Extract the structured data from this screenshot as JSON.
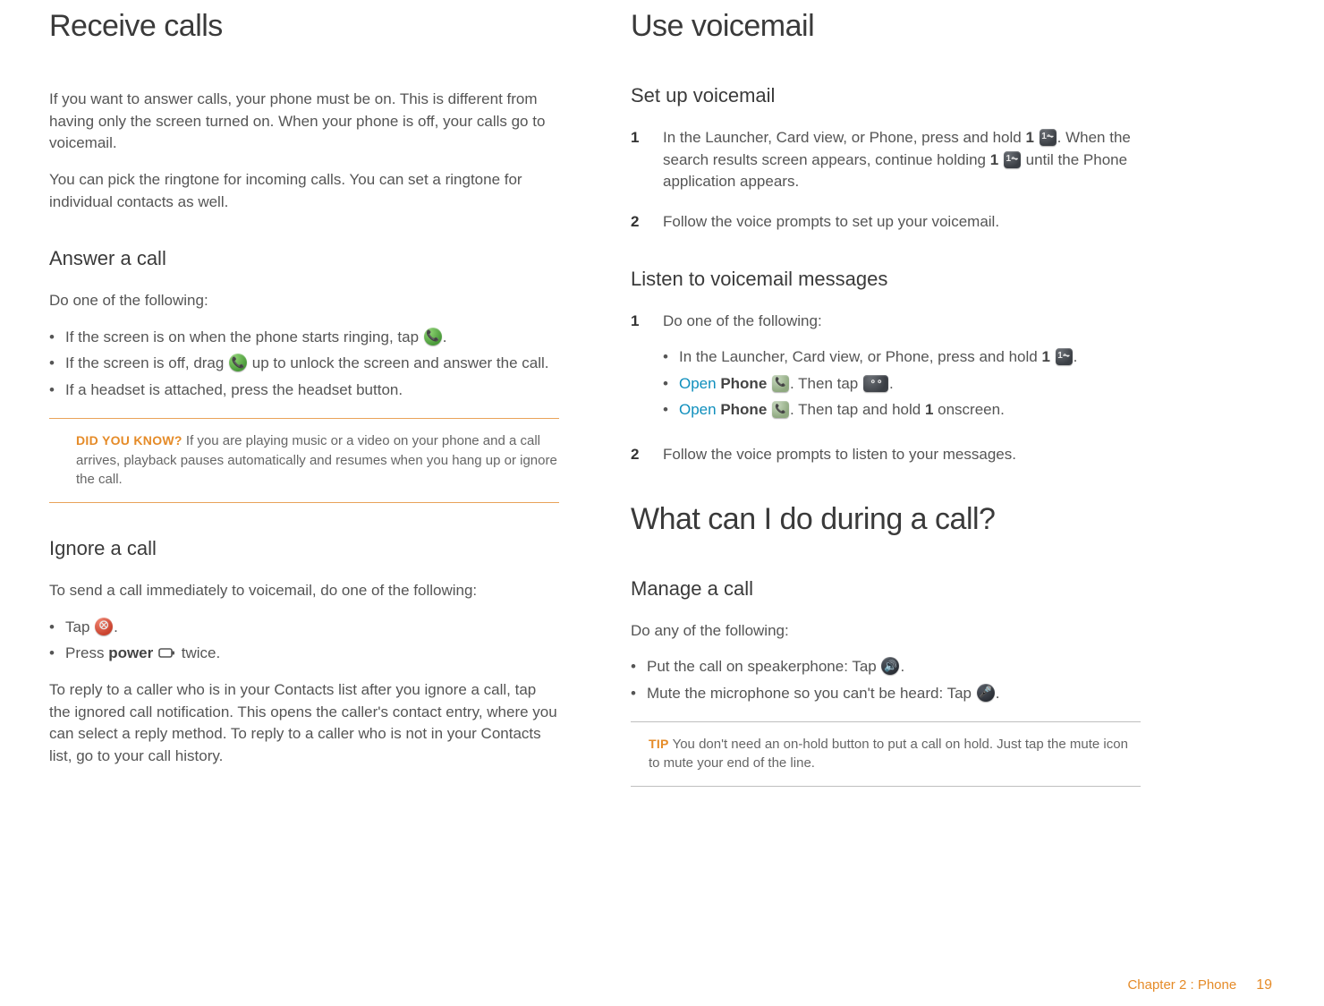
{
  "left": {
    "h1": "Receive calls",
    "intro1": "If you want to answer calls, your phone must be on. This is different from having only the screen turned on. When your phone is off, your calls go to voicemail.",
    "intro2": "You can pick the ringtone for incoming calls. You can set a ringtone for individual contacts as well.",
    "answer_h2": "Answer a call",
    "answer_lead": "Do one of the following:",
    "answer_b1a": "If the screen is on when the phone starts ringing, tap ",
    "answer_b1b": ".",
    "answer_b2a": "If the screen is off, drag ",
    "answer_b2b": " up to unlock the screen and answer the call.",
    "answer_b3": "If a headset is attached, press the headset button.",
    "dyk_label": "DID YOU KNOW?",
    "dyk_body": "  If you are playing music or a video on your phone and a call arrives, playback pauses automatically and resumes when you hang up or ignore the call.",
    "ignore_h2": "Ignore a call",
    "ignore_lead": "To send a call immediately to voicemail, do one of the following:",
    "ignore_b1a": "Tap ",
    "ignore_b1b": ".",
    "ignore_b2a": "Press ",
    "ignore_b2_strong": "power",
    "ignore_b2b": " twice.",
    "ignore_para": "To reply to a caller who is in your Contacts list after you ignore a call, tap the ignored call notification. This opens the caller's contact entry, where you can select a reply method. To reply to a caller who is not in your Contacts list, go to your call history."
  },
  "right": {
    "h1": "Use voicemail",
    "setup_h2": "Set up voicemail",
    "setup_s1a": "In the Launcher, Card view, or Phone, press and hold ",
    "setup_s1_1a": "1",
    "setup_s1b": ". When the search results screen appears, continue holding ",
    "setup_s1_1b": "1",
    "setup_s1c": " until the Phone application appears.",
    "setup_s2": "Follow the voice prompts to set up your voicemail.",
    "listen_h2": "Listen to voicemail messages",
    "listen_s1": "Do one of the following:",
    "listen_b1a": "In the Launcher, Card view, or Phone, press and hold ",
    "listen_b1_1": "1",
    "listen_b1b": ".",
    "listen_b2_open": "Open",
    "listen_b2_phone": "Phone",
    "listen_b2a": ". Then tap ",
    "listen_b2b": ".",
    "listen_b3_open": "Open",
    "listen_b3_phone": "Phone",
    "listen_b3a": ". Then tap and hold ",
    "listen_b3_1": "1",
    "listen_b3b": " onscreen.",
    "listen_s2": "Follow the voice prompts to listen to your messages.",
    "during_h1": "What can I do during a call?",
    "manage_h2": "Manage a call",
    "manage_lead": "Do any of the following:",
    "manage_b1a": "Put the call on speakerphone: Tap ",
    "manage_b1b": ".",
    "manage_b2a": "Mute the microphone so you can't be heard: Tap ",
    "manage_b2b": ".",
    "tip_label": "TIP",
    "tip_body": "  You don't need an on-hold button to put a call on hold. Just tap the mute icon to mute your end of the line."
  },
  "footer": {
    "chapter": "Chapter 2 : Phone",
    "page": "19"
  }
}
